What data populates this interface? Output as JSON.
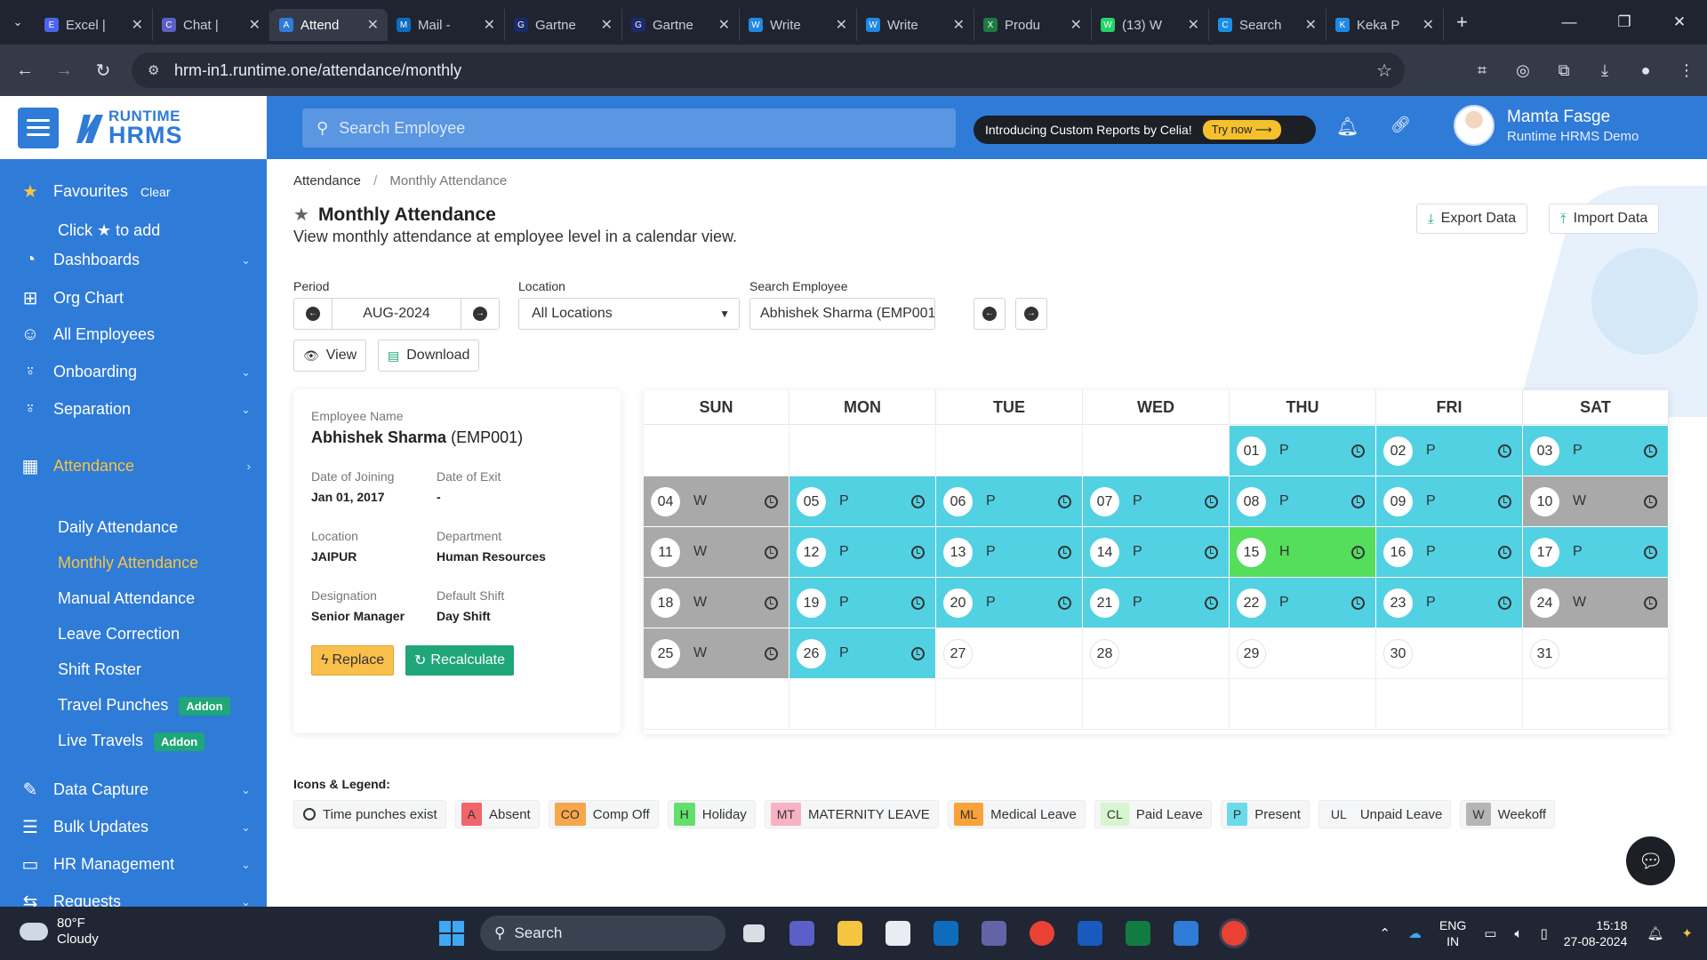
{
  "browser": {
    "tabs": [
      {
        "title": "Excel |",
        "color": "#4a64f0",
        "icon": "E"
      },
      {
        "title": "Chat |",
        "color": "#5b5fc7",
        "icon": "C"
      },
      {
        "title": "Attend",
        "color": "#2f7bd8",
        "icon": "A",
        "active": true
      },
      {
        "title": "Mail -",
        "color": "#0f6cbd",
        "icon": "M"
      },
      {
        "title": "Gartne",
        "color": "#1c2a6b",
        "icon": "G"
      },
      {
        "title": "Gartne",
        "color": "#1c2a6b",
        "icon": "G"
      },
      {
        "title": "Write",
        "color": "#1f88e5",
        "icon": "W"
      },
      {
        "title": "Write",
        "color": "#1f88e5",
        "icon": "W"
      },
      {
        "title": "Produ",
        "color": "#1d7a43",
        "icon": "X"
      },
      {
        "title": "(13) W",
        "color": "#25d366",
        "icon": "W"
      },
      {
        "title": "Search",
        "color": "#1b8ee8",
        "icon": "C"
      },
      {
        "title": "Keka P",
        "color": "#1f88e5",
        "icon": "K"
      }
    ],
    "url": "hrm-in1.runtime.one/attendance/monthly"
  },
  "header": {
    "logo_top": "RUNTIME",
    "logo_bottom": "HRMS",
    "search_placeholder": "Search Employee",
    "promo_text": "Introducing Custom Reports by Celia!",
    "promo_button": "Try now ⟶",
    "user_name": "Mamta Fasge",
    "user_company": "Runtime HRMS Demo"
  },
  "sidebar": {
    "favourites_label": "Favourites",
    "clear_label": "Clear",
    "click_add_pre": "Click",
    "click_add_post": "to add",
    "items": [
      {
        "label": "Dashboards",
        "icon": "dashboard-icon"
      },
      {
        "label": "Org Chart",
        "icon": "org-chart-icon"
      },
      {
        "label": "All Employees",
        "icon": "employees-icon"
      },
      {
        "label": "Onboarding",
        "icon": "onboarding-icon"
      },
      {
        "label": "Separation",
        "icon": "separation-icon"
      },
      {
        "label": "Attendance",
        "icon": "calendar-icon"
      },
      {
        "label": "Data Capture",
        "icon": "edit-icon"
      },
      {
        "label": "Bulk Updates",
        "icon": "list-icon"
      },
      {
        "label": "HR Management",
        "icon": "id-card-icon"
      },
      {
        "label": "Requests",
        "icon": "swap-icon"
      }
    ],
    "attendance_sub": [
      {
        "label": "Daily Attendance"
      },
      {
        "label": "Monthly Attendance",
        "active": true
      },
      {
        "label": "Manual Attendance"
      },
      {
        "label": "Leave Correction"
      },
      {
        "label": "Shift Roster"
      },
      {
        "label": "Travel Punches",
        "badge": "Addon"
      },
      {
        "label": "Live Travels",
        "badge": "Addon"
      }
    ]
  },
  "page": {
    "breadcrumb_root": "Attendance",
    "breadcrumb_current": "Monthly Attendance",
    "title": "Monthly Attendance",
    "subtitle": "View monthly attendance at employee level in a calendar view.",
    "export_label": "Export Data",
    "import_label": "Import Data",
    "period_label": "Period",
    "period_value": "AUG-2024",
    "location_label": "Location",
    "location_value": "All Locations",
    "search_emp_label": "Search Employee",
    "search_emp_value": "Abhishek Sharma (EMP001)",
    "view_label": "View",
    "download_label": "Download"
  },
  "employee": {
    "name_label": "Employee Name",
    "name": "Abhishek Sharma",
    "code": "(EMP001)",
    "doj_label": "Date of Joining",
    "doj": "Jan 01, 2017",
    "doe_label": "Date of Exit",
    "doe": "-",
    "location_label": "Location",
    "location": "JAIPUR",
    "department_label": "Department",
    "department": "Human Resources",
    "designation_label": "Designation",
    "designation": "Senior Manager",
    "shift_label": "Default Shift",
    "shift": "Day Shift",
    "replace_label": "Replace",
    "recalc_label": "Recalculate"
  },
  "calendar": {
    "weekdays": [
      "SUN",
      "MON",
      "TUE",
      "WED",
      "THU",
      "FRI",
      "SAT"
    ],
    "first_weekday_index": 4,
    "days": [
      {
        "d": "01",
        "s": "P"
      },
      {
        "d": "02",
        "s": "P"
      },
      {
        "d": "03",
        "s": "P"
      },
      {
        "d": "04",
        "s": "W"
      },
      {
        "d": "05",
        "s": "P"
      },
      {
        "d": "06",
        "s": "P"
      },
      {
        "d": "07",
        "s": "P"
      },
      {
        "d": "08",
        "s": "P"
      },
      {
        "d": "09",
        "s": "P"
      },
      {
        "d": "10",
        "s": "W"
      },
      {
        "d": "11",
        "s": "W"
      },
      {
        "d": "12",
        "s": "P"
      },
      {
        "d": "13",
        "s": "P"
      },
      {
        "d": "14",
        "s": "P"
      },
      {
        "d": "15",
        "s": "H"
      },
      {
        "d": "16",
        "s": "P"
      },
      {
        "d": "17",
        "s": "P"
      },
      {
        "d": "18",
        "s": "W"
      },
      {
        "d": "19",
        "s": "P"
      },
      {
        "d": "20",
        "s": "P"
      },
      {
        "d": "21",
        "s": "P"
      },
      {
        "d": "22",
        "s": "P"
      },
      {
        "d": "23",
        "s": "P"
      },
      {
        "d": "24",
        "s": "W"
      },
      {
        "d": "25",
        "s": "W"
      },
      {
        "d": "26",
        "s": "P"
      },
      {
        "d": "27",
        "s": ""
      },
      {
        "d": "28",
        "s": ""
      },
      {
        "d": "29",
        "s": ""
      },
      {
        "d": "30",
        "s": ""
      },
      {
        "d": "31",
        "s": ""
      }
    ],
    "status_colors": {
      "P": "#52d1e3",
      "W": "#a9a9a9",
      "H": "#55dd5c"
    }
  },
  "legend": {
    "title": "Icons & Legend:",
    "time_punches": "Time punches exist",
    "items": [
      {
        "code": "A",
        "label": "Absent",
        "color": "#f2646b"
      },
      {
        "code": "CO",
        "label": "Comp Off",
        "color": "#f6a64b"
      },
      {
        "code": "H",
        "label": "Holiday",
        "color": "#63e06b"
      },
      {
        "code": "MT",
        "label": "MATERNITY LEAVE",
        "color": "#f7b2c4"
      },
      {
        "code": "ML",
        "label": "Medical Leave",
        "color": "#f9a23a"
      },
      {
        "code": "CL",
        "label": "Paid Leave",
        "color": "#d6f5d0"
      },
      {
        "code": "P",
        "label": "Present",
        "color": "#6bdbeb"
      },
      {
        "code": "UL",
        "label": "Unpaid Leave",
        "color": "#f5f6f7"
      },
      {
        "code": "W",
        "label": "Weekoff",
        "color": "#b5b5b5"
      }
    ]
  },
  "taskbar": {
    "temp": "80°F",
    "weather": "Cloudy",
    "search": "Search",
    "lang1": "ENG",
    "lang2": "IN",
    "time": "15:18",
    "date": "27-08-2024"
  }
}
